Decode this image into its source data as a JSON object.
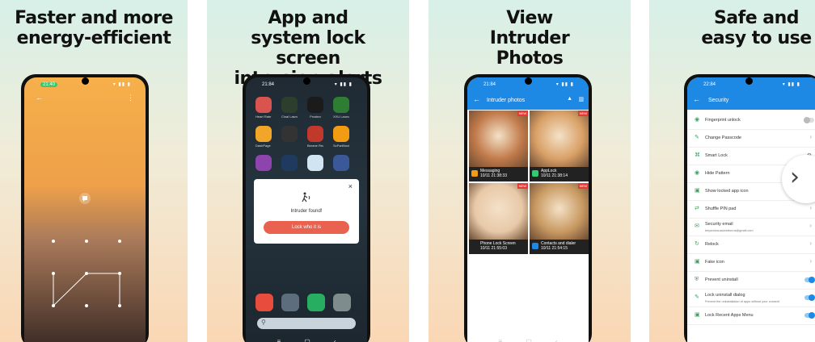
{
  "panels": [
    {
      "title": "Faster and more energy-efficient"
    },
    {
      "title": "App and system lock screen intrusion alerts"
    },
    {
      "title": "View Intruder Photos"
    },
    {
      "title": "Safe and easy to use"
    }
  ],
  "phone1": {
    "status_time": "21:40",
    "status_icons": "▾ ▮▮ ▮"
  },
  "phone2": {
    "status_time": "21:84",
    "status_icons": "▾ ▮▮ ▮",
    "apps": [
      {
        "label": "Heart Rate M...",
        "color": "#d9534f"
      },
      {
        "label": "Cinal Lawnche...",
        "color": "#2c3e2c"
      },
      {
        "label": "Prosteo",
        "color": "#1b1b1b"
      },
      {
        "label": "XXU Launcher",
        "color": "#2e7d32"
      },
      {
        "label": "DashPage p...",
        "color": "#f1a629"
      },
      {
        "label": "",
        "color": "#333333"
      },
      {
        "label": "Berane Rea...",
        "color": "#c0392b"
      },
      {
        "label": "ScPartNoxive",
        "color": "#f39c12"
      },
      {
        "label": "",
        "color": "#8e44ad"
      },
      {
        "label": "",
        "color": "#1e3a5f"
      },
      {
        "label": "",
        "color": "#d0e4f2"
      },
      {
        "label": "",
        "color": "#3b5998"
      }
    ],
    "dialog_message": "Intruder found!",
    "dialog_button": "Lock who it is",
    "dialog_close": "×",
    "dock_colors": [
      "#e74c3c",
      "#5d6d7e",
      "#27ae60",
      "#7f8c8d"
    ]
  },
  "phone3": {
    "status_time": "21:84",
    "status_icons": "▾ ▮▮ ▮",
    "appbar_title": "Intruder photos",
    "tiles": [
      {
        "app": "Messaging",
        "time": "10/11 21:38:33",
        "badge": "NEW",
        "icon_color": "#f39c12",
        "img": "#c17a4a"
      },
      {
        "app": "AppLock",
        "time": "10/11 21:38:14",
        "badge": "NEW",
        "icon_color": "#2ecc71",
        "img": "#d9a066"
      },
      {
        "app": "Phone Lock Screen",
        "time": "10/11 21:55:03",
        "badge": "NEW",
        "icon_color": "#222222",
        "img": "#e8c9a8"
      },
      {
        "app": "Contacts and dialer",
        "time": "10/11 21:54:15",
        "badge": "NEW",
        "icon_color": "#1e88e5",
        "img": "#c99a62"
      }
    ]
  },
  "phone4": {
    "status_time": "22:84",
    "status_icons": "▾ ▮▮ ▮",
    "appbar_title": "Security",
    "rows": [
      {
        "label": "Fingerprint unlock",
        "sub": "",
        "control": "toggle-off",
        "icon": "◉"
      },
      {
        "label": "Change Passcode",
        "sub": "",
        "control": "chevron",
        "icon": "✎"
      },
      {
        "label": "Smart Lock",
        "sub": "",
        "control": "gear",
        "icon": "⌘"
      },
      {
        "label": "Hide Pattern",
        "sub": "",
        "control": "chevron",
        "icon": "◉"
      },
      {
        "label": "Show locked app icon",
        "sub": "",
        "control": "chevron",
        "icon": "▣"
      },
      {
        "label": "Shuffle PIN pad",
        "sub": "",
        "control": "chevron",
        "icon": "⇄"
      },
      {
        "label": "Security email",
        "sub": "beyondow.asiwidew.us@gmail.com",
        "control": "chevron",
        "icon": "✉"
      },
      {
        "label": "Relock",
        "sub": "",
        "control": "chevron",
        "icon": "↻"
      },
      {
        "label": "Fake icon",
        "sub": "",
        "control": "chevron",
        "icon": "▣"
      },
      {
        "label": "Prevent uninstall",
        "sub": "",
        "control": "toggle-on",
        "icon": "⛨"
      },
      {
        "label": "Lock uninstall dialog",
        "sub": "Prevent the uninstallation of apps without your consent",
        "control": "toggle-on",
        "icon": "✎"
      },
      {
        "label": "Lock Recent Apps Menu",
        "sub": "",
        "control": "toggle-on",
        "icon": "▣"
      }
    ]
  },
  "colors": {
    "accent": "#1e88e5",
    "alert_button": "#e8624f",
    "icon_green": "#3aa35a"
  }
}
